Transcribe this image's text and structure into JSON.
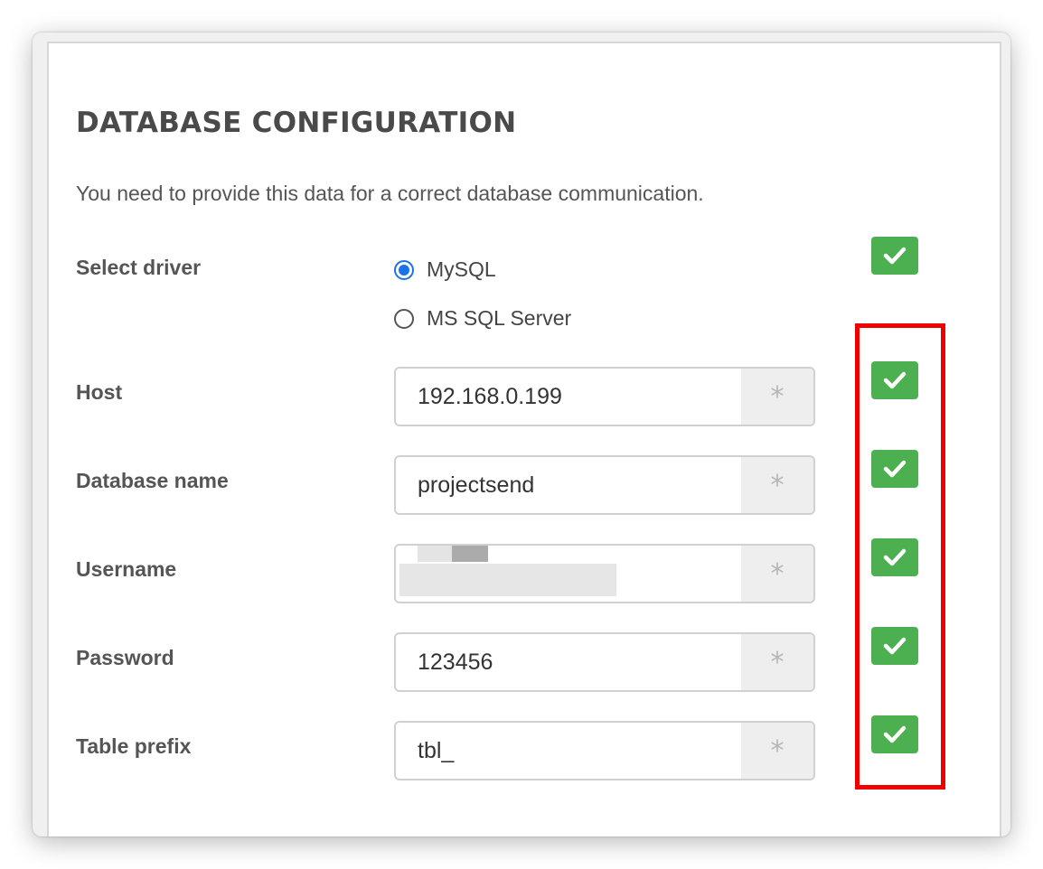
{
  "header": {
    "title": "DATABASE CONFIGURATION",
    "description": "You need to provide this data for a correct database communication."
  },
  "driver": {
    "label": "Select driver",
    "options": [
      {
        "label": "MySQL",
        "selected": true
      },
      {
        "label": "MS SQL Server",
        "selected": false
      }
    ]
  },
  "fields": {
    "host": {
      "label": "Host",
      "value": "192.168.0.199",
      "addon": "*"
    },
    "database_name": {
      "label": "Database name",
      "value": "projectsend",
      "addon": "*"
    },
    "username": {
      "label": "Username",
      "value": "",
      "addon": "*"
    },
    "password": {
      "label": "Password",
      "value": "123456",
      "addon": "*"
    },
    "table_prefix": {
      "label": "Table prefix",
      "value": "tbl_",
      "addon": "*"
    }
  },
  "colors": {
    "check_badge": "#4caf50",
    "highlight_border": "#ee0000",
    "radio_selected": "#1a73e8"
  },
  "icons": {
    "validation": "check-icon",
    "required": "asterisk-icon"
  }
}
